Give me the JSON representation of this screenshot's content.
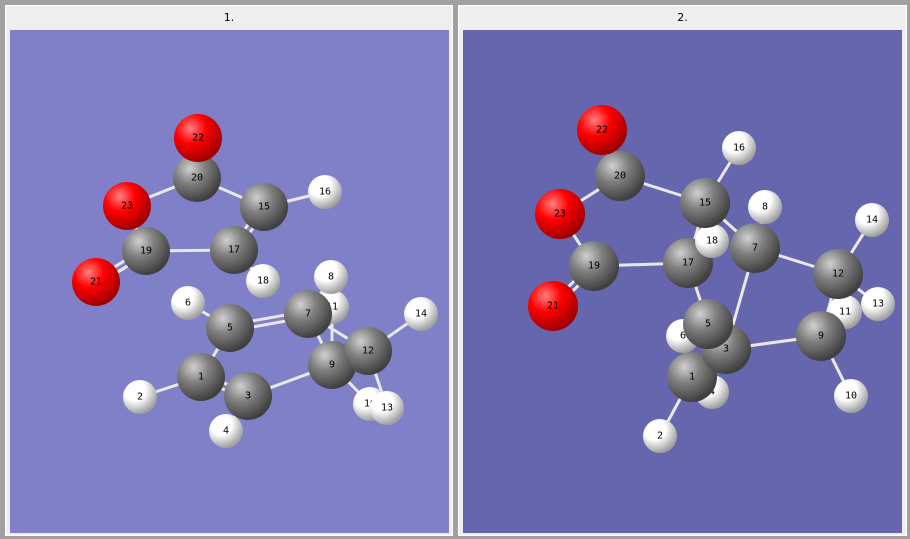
{
  "panels": [
    {
      "title": "1.",
      "background": "#8080c8",
      "atoms": [
        {
          "id": "1",
          "el": "C"
        },
        {
          "id": "2",
          "el": "H"
        },
        {
          "id": "3",
          "el": "C"
        },
        {
          "id": "4",
          "el": "H"
        },
        {
          "id": "5",
          "el": "C"
        },
        {
          "id": "6",
          "el": "H"
        },
        {
          "id": "7",
          "el": "C"
        },
        {
          "id": "8",
          "el": "H"
        },
        {
          "id": "9",
          "el": "C"
        },
        {
          "id": "10",
          "el": "H"
        },
        {
          "id": "11",
          "el": "H"
        },
        {
          "id": "12",
          "el": "C"
        },
        {
          "id": "13",
          "el": "H"
        },
        {
          "id": "14",
          "el": "H"
        },
        {
          "id": "15",
          "el": "C"
        },
        {
          "id": "16",
          "el": "H"
        },
        {
          "id": "17",
          "el": "C"
        },
        {
          "id": "18",
          "el": "H"
        },
        {
          "id": "19",
          "el": "C"
        },
        {
          "id": "20",
          "el": "C"
        },
        {
          "id": "21",
          "el": "O"
        },
        {
          "id": "22",
          "el": "O"
        },
        {
          "id": "23",
          "el": "O"
        }
      ]
    },
    {
      "title": "2.",
      "background": "#6666ae",
      "atoms": [
        {
          "id": "1",
          "el": "C"
        },
        {
          "id": "2",
          "el": "H"
        },
        {
          "id": "3",
          "el": "C"
        },
        {
          "id": "4",
          "el": "H"
        },
        {
          "id": "5",
          "el": "C"
        },
        {
          "id": "6",
          "el": "H"
        },
        {
          "id": "7",
          "el": "C"
        },
        {
          "id": "8",
          "el": "H"
        },
        {
          "id": "9",
          "el": "C"
        },
        {
          "id": "10",
          "el": "H"
        },
        {
          "id": "11",
          "el": "H"
        },
        {
          "id": "12",
          "el": "C"
        },
        {
          "id": "13",
          "el": "H"
        },
        {
          "id": "14",
          "el": "H"
        },
        {
          "id": "15",
          "el": "C"
        },
        {
          "id": "16",
          "el": "H"
        },
        {
          "id": "17",
          "el": "C"
        },
        {
          "id": "18",
          "el": "H"
        },
        {
          "id": "19",
          "el": "C"
        },
        {
          "id": "20",
          "el": "C"
        },
        {
          "id": "21",
          "el": "O"
        },
        {
          "id": "22",
          "el": "O"
        },
        {
          "id": "23",
          "el": "O"
        }
      ]
    }
  ],
  "element_colors": {
    "C": "#808080",
    "H": "#ffffff",
    "O": "#ff0000"
  }
}
